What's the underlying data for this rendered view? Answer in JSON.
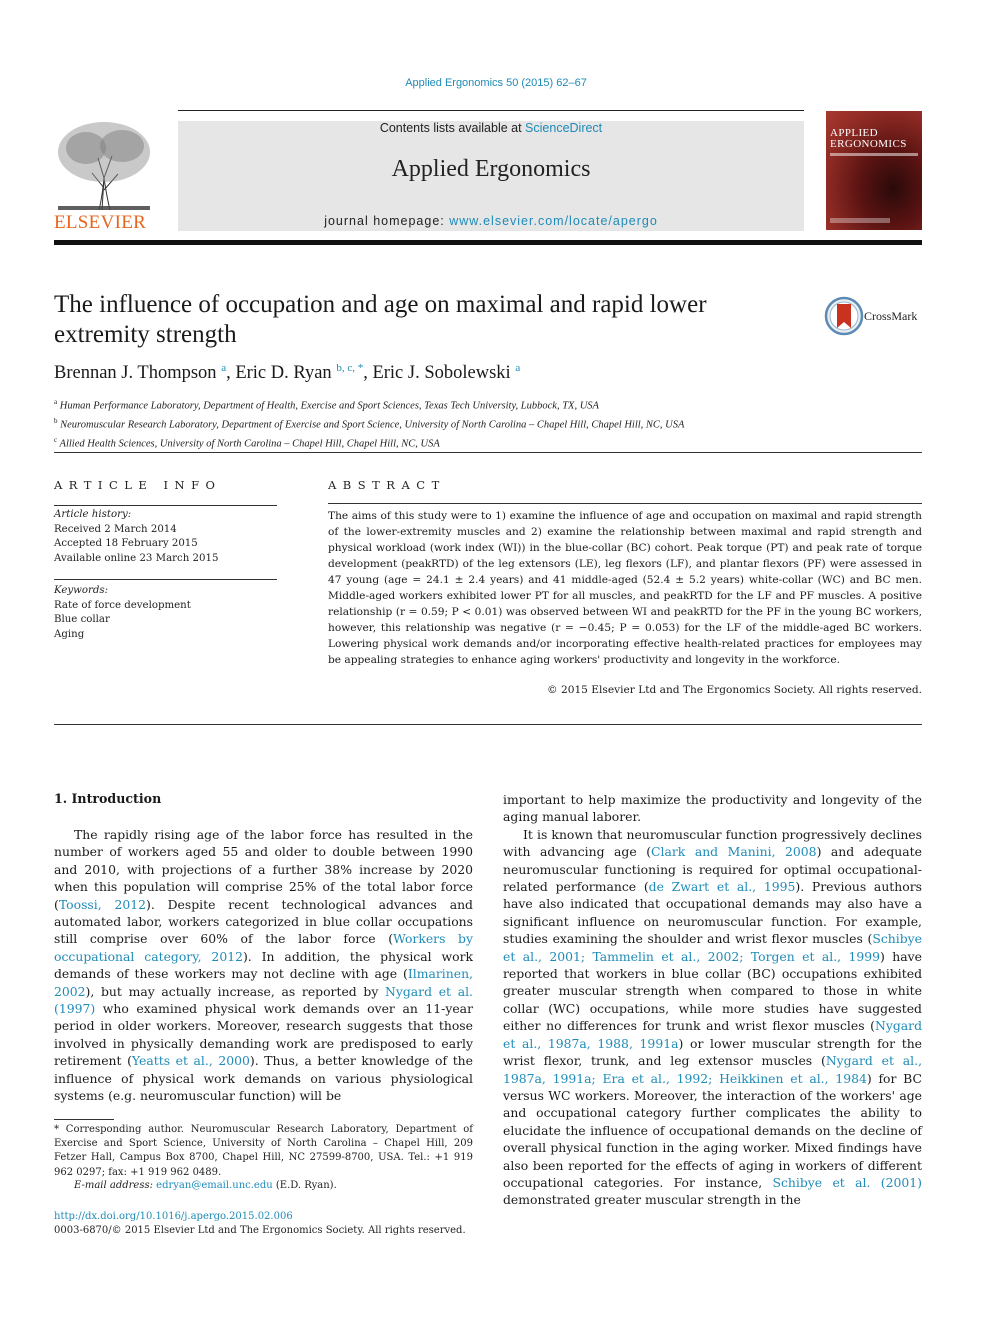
{
  "header": {
    "citation": "Applied Ergonomics 50 (2015) 62–67",
    "contents_prefix": "Contents lists available at ",
    "contents_link": "ScienceDirect",
    "journal_title": "Applied Ergonomics",
    "homepage_prefix": "journal homepage: ",
    "homepage_link": "www.elsevier.com/locate/apergo",
    "publisher": "ELSEVIER",
    "cover_title_line1": "APPLIED",
    "cover_title_line2": "ERGONOMICS",
    "crossmark": "CrossMark"
  },
  "article": {
    "title": "The influence of occupation and age on maximal and rapid lower extremity strength",
    "authors": [
      {
        "name": "Brennan J. Thompson",
        "sup": "a"
      },
      {
        "name": "Eric D. Ryan",
        "sup": "b, c, *"
      },
      {
        "name": "Eric J. Sobolewski",
        "sup": "a"
      }
    ],
    "affiliations": [
      {
        "sup": "a",
        "text": "Human Performance Laboratory, Department of Health, Exercise and Sport Sciences, Texas Tech University, Lubbock, TX, USA"
      },
      {
        "sup": "b",
        "text": "Neuromuscular Research Laboratory, Department of Exercise and Sport Science, University of North Carolina – Chapel Hill, Chapel Hill, NC, USA"
      },
      {
        "sup": "c",
        "text": "Allied Health Sciences, University of North Carolina – Chapel Hill, Chapel Hill, NC, USA"
      }
    ]
  },
  "article_info": {
    "heading": "ARTICLE INFO",
    "history_label": "Article history:",
    "history": [
      "Received 2 March 2014",
      "Accepted 18 February 2015",
      "Available online 23 March 2015"
    ],
    "keywords_label": "Keywords:",
    "keywords": [
      "Rate of force development",
      "Blue collar",
      "Aging"
    ]
  },
  "abstract": {
    "heading": "ABSTRACT",
    "text": "The aims of this study were to 1) examine the influence of age and occupation on maximal and rapid strength of the lower-extremity muscles and 2) examine the relationship between maximal and rapid strength and physical workload (work index (WI)) in the blue-collar (BC) cohort. Peak torque (PT) and peak rate of torque development (peakRTD) of the leg extensors (LE), leg flexors (LF), and plantar flexors (PF) were assessed in 47 young (age = 24.1 ± 2.4 years) and 41 middle-aged (52.4 ± 5.2 years) white-collar (WC) and BC men. Middle-aged workers exhibited lower PT for all muscles, and peakRTD for the LF and PF muscles. A positive relationship (r = 0.59; P < 0.01) was observed between WI and peakRTD for the PF in the young BC workers, however, this relationship was negative (r = −0.45; P = 0.053) for the LF of the middle-aged BC workers. Lowering physical work demands and/or incorporating effective health-related practices for employees may be appealing strategies to enhance aging workers' productivity and longevity in the workforce.",
    "copyright": "© 2015 Elsevier Ltd and The Ergonomics Society. All rights reserved."
  },
  "body": {
    "section_heading": "1.  Introduction",
    "left_paragraph": [
      {
        "t": "The rapidly rising age of the labor force has resulted in the number of workers aged 55 and older to double between 1990 and 2010, with projections of a further 38% increase by 2020 when this population will comprise 25% of the total labor force ("
      },
      {
        "link": "Toossi, 2012"
      },
      {
        "t": "). Despite recent technological advances and automated labor, workers categorized in blue collar occupations still comprise over 60% of the labor force ("
      },
      {
        "link": "Workers by occupational category, 2012"
      },
      {
        "t": "). In addition, the physical work demands of these workers may not decline with age ("
      },
      {
        "link": "Ilmarinen, 2002"
      },
      {
        "t": "), but may actually increase, as reported by "
      },
      {
        "link": "Nygard et al. (1997)"
      },
      {
        "t": " who examined physical work demands over an 11-year period in older workers. Moreover, research suggests that those involved in physically demanding work are predisposed to early retirement ("
      },
      {
        "link": "Yeatts et al., 2000"
      },
      {
        "t": "). Thus, a better knowledge of the influence of physical work demands on various physiological systems (e.g. neuromuscular function) will be"
      }
    ],
    "right_paragraph_1": "important to help maximize the productivity and longevity of the aging manual laborer.",
    "right_paragraph_2": [
      {
        "t": "It is known that neuromuscular function progressively declines with advancing age ("
      },
      {
        "link": "Clark and Manini, 2008"
      },
      {
        "t": ") and adequate neuromuscular functioning is required for optimal occupational-related performance ("
      },
      {
        "link": "de Zwart et al., 1995"
      },
      {
        "t": "). Previous authors have also indicated that occupational demands may also have a significant influence on neuromuscular function. For example, studies examining the shoulder and wrist flexor muscles ("
      },
      {
        "link": "Schibye et al., 2001; Tammelin et al., 2002; Torgen et al., 1999"
      },
      {
        "t": ") have reported that workers in blue collar (BC) occupations exhibited greater muscular strength when compared to those in white collar (WC) occupations, while more studies have suggested either no differences for trunk and wrist flexor muscles ("
      },
      {
        "link": "Nygard et al., 1987a, 1988, 1991a"
      },
      {
        "t": ") or lower muscular strength for the wrist flexor, trunk, and leg extensor muscles ("
      },
      {
        "link": "Nygard et al., 1987a, 1991a; Era et al., 1992; Heikkinen et al., 1984"
      },
      {
        "t": ") for BC versus WC workers. Moreover, the interaction of the workers' age and occupational category further complicates the ability to elucidate the influence of occupational demands on the decline of overall physical function in the aging worker. Mixed findings have also been reported for the effects of aging in workers of different occupational categories. For instance, "
      },
      {
        "link": "Schibye et al. (2001)"
      },
      {
        "t": " demonstrated greater muscular strength in the"
      }
    ]
  },
  "footnotes": {
    "corresponding": "* Corresponding author. Neuromuscular Research Laboratory, Department of Exercise and Sport Science, University of North Carolina – Chapel Hill, 209 Fetzer Hall, Campus Box 8700, Chapel Hill, NC 27599-8700, USA. Tel.: +1 919 962 0297; fax: +1 919 962 0489.",
    "email_label": "E-mail address: ",
    "email": "edryan@email.unc.edu",
    "email_suffix": " (E.D. Ryan).",
    "doi": "http://dx.doi.org/10.1016/j.apergo.2015.02.006",
    "issn": "0003-6870/© 2015 Elsevier Ltd and The Ergonomics Society. All rights reserved."
  }
}
